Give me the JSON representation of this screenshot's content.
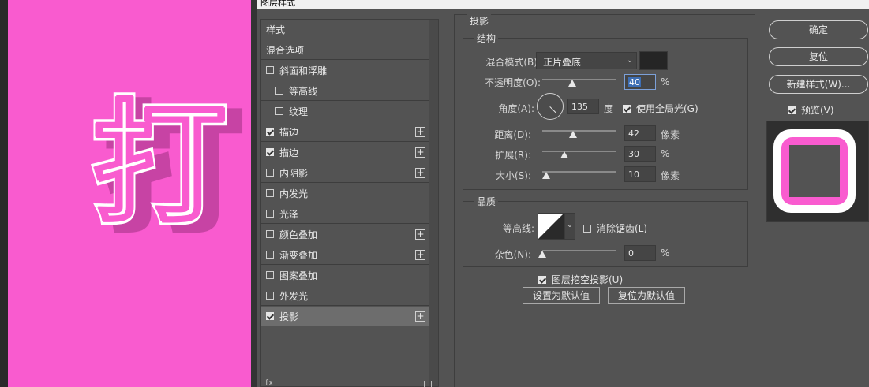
{
  "window_title": "图层样式",
  "canvas": {
    "character": "打",
    "background_color": "#f95bcf"
  },
  "style_list": {
    "items": [
      {
        "label": "样式",
        "checkbox": false,
        "plus": false,
        "indent": false
      },
      {
        "label": "混合选项",
        "checkbox": false,
        "plus": false,
        "indent": false
      },
      {
        "label": "斜面和浮雕",
        "checkbox": true,
        "checked": false,
        "plus": false,
        "indent": false
      },
      {
        "label": "等高线",
        "checkbox": true,
        "checked": false,
        "plus": false,
        "indent": true
      },
      {
        "label": "纹理",
        "checkbox": true,
        "checked": false,
        "plus": false,
        "indent": true
      },
      {
        "label": "描边",
        "checkbox": true,
        "checked": true,
        "plus": true,
        "indent": false
      },
      {
        "label": "描边",
        "checkbox": true,
        "checked": true,
        "plus": true,
        "indent": false
      },
      {
        "label": "内阴影",
        "checkbox": true,
        "checked": false,
        "plus": true,
        "indent": false
      },
      {
        "label": "内发光",
        "checkbox": true,
        "checked": false,
        "plus": false,
        "indent": false
      },
      {
        "label": "光泽",
        "checkbox": true,
        "checked": false,
        "plus": false,
        "indent": false
      },
      {
        "label": "颜色叠加",
        "checkbox": true,
        "checked": false,
        "plus": true,
        "indent": false
      },
      {
        "label": "渐变叠加",
        "checkbox": true,
        "checked": false,
        "plus": true,
        "indent": false
      },
      {
        "label": "图案叠加",
        "checkbox": true,
        "checked": false,
        "plus": false,
        "indent": false
      },
      {
        "label": "外发光",
        "checkbox": true,
        "checked": false,
        "plus": false,
        "indent": false
      },
      {
        "label": "投影",
        "checkbox": true,
        "checked": true,
        "plus": true,
        "indent": false,
        "selected": true
      }
    ],
    "fx_label": "fx"
  },
  "drop_shadow": {
    "panel_title": "投影",
    "structure": {
      "title": "结构",
      "blend_mode_label": "混合模式(B):",
      "blend_mode_value": "正片叠底",
      "shadow_color": "#252525",
      "opacity_label": "不透明度(O):",
      "opacity_value": "40",
      "opacity_unit": "%",
      "opacity_fraction": 0.4,
      "angle_label": "角度(A):",
      "angle_value": "135",
      "angle_unit": "度",
      "global_light_label": "使用全局光(G)",
      "global_light_checked": true,
      "distance_label": "距离(D):",
      "distance_value": "42",
      "distance_unit": "像素",
      "distance_fraction": 0.42,
      "spread_label": "扩展(R):",
      "spread_value": "30",
      "spread_unit": "%",
      "spread_fraction": 0.3,
      "size_label": "大小(S):",
      "size_value": "10",
      "size_unit": "像素",
      "size_fraction": 0.05
    },
    "quality": {
      "title": "品质",
      "contour_label": "等高线:",
      "anti_alias_label": "消除锯齿(L)",
      "anti_alias_checked": false,
      "noise_label": "杂色(N):",
      "noise_value": "0",
      "noise_unit": "%",
      "noise_fraction": 0
    },
    "knockout_label": "图层挖空投影(U)",
    "knockout_checked": true,
    "set_default_label": "设置为默认值",
    "reset_default_label": "复位为默认值"
  },
  "side": {
    "ok_label": "确定",
    "reset_label": "复位",
    "new_style_label": "新建样式(W)...",
    "preview_label": "预览(V)",
    "preview_checked": true
  }
}
